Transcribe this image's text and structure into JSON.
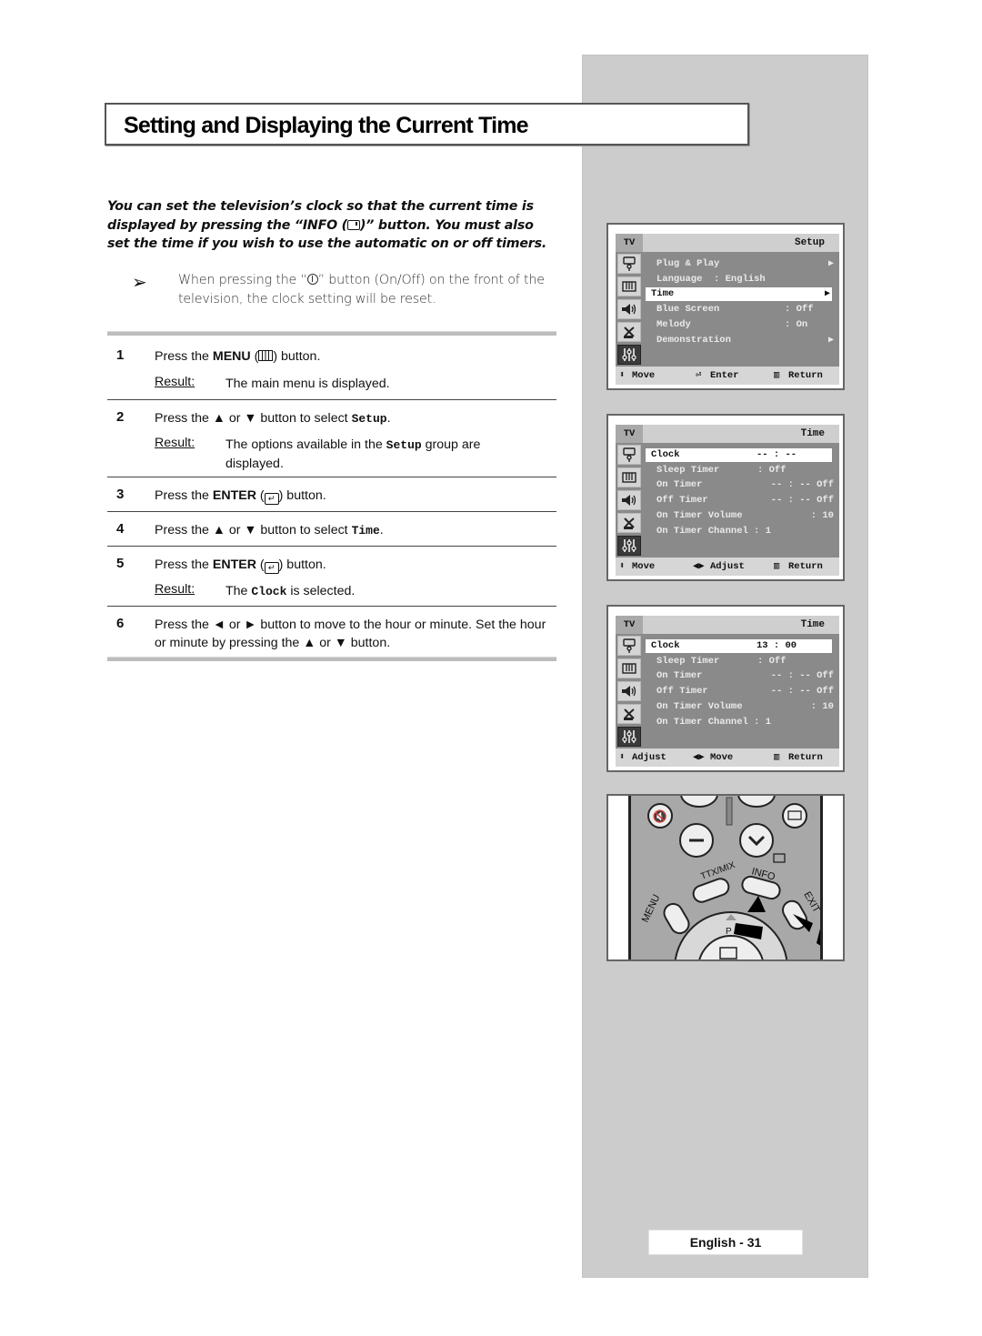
{
  "page": {
    "title": "Setting and Displaying the Current Time",
    "intro": {
      "part1": "You can set the television’s clock so that the current time is displayed by pressing the “INFO (",
      "part2": ")” button. You must also set the time if you wish to use the automatic on or off timers."
    },
    "note": {
      "arrow_icon": "➢",
      "part1": "When pressing the “",
      "part2": "” button (On/Off) on the front of the television, the clock setting will be reset."
    },
    "result_label": "Result:",
    "steps": [
      {
        "number": "1",
        "pre": "Press the ",
        "bold": "MENU",
        "mid": " (",
        "post": ") button.",
        "result": "The main menu is displayed."
      },
      {
        "number": "2",
        "pre": "Press the ▲ or ▼ button to select ",
        "mono": "Setup",
        "post": ".",
        "result_pre": "The options available in the ",
        "result_mono": "Setup",
        "result_post": " group are displayed."
      },
      {
        "number": "3",
        "pre": "Press the ",
        "bold": "ENTER",
        "mid": " (",
        "post": ") button."
      },
      {
        "number": "4",
        "pre": "Press the ▲ or ▼ button to select ",
        "mono": "Time",
        "post": "."
      },
      {
        "number": "5",
        "pre": "Press the ",
        "bold": "ENTER",
        "mid": " (",
        "post": ") button.",
        "result_pre": "The ",
        "result_mono": "Clock",
        "result_post": " is selected."
      },
      {
        "number": "6",
        "text": "Press the ◄ or ► button to move to the hour or minute. Set the hour or minute by pressing the ▲ or ▼ button."
      }
    ],
    "page_number": "English - 31"
  },
  "osd_panels": [
    {
      "tv_label": "TV",
      "title": "Setup",
      "rows": [
        {
          "label": "Plug & Play",
          "value": "",
          "arrow": "▶"
        },
        {
          "label": "Language  : English",
          "value": "",
          "arrow": ""
        },
        {
          "label": "Time",
          "value": "",
          "arrow": "▶",
          "selected": true
        },
        {
          "label": "Blue Screen",
          "value": ": Off",
          "arrow": ""
        },
        {
          "label": "Melody",
          "value": ": On",
          "arrow": ""
        },
        {
          "label": "Demonstration",
          "value": "",
          "arrow": "▶"
        }
      ],
      "footer": {
        "left_icon": "⬍",
        "left": "Move",
        "mid_icon": "enter-icon",
        "mid": "Enter",
        "right": "Return"
      }
    },
    {
      "tv_label": "TV",
      "title": "Time",
      "rows": [
        {
          "label": "Clock",
          "value": "-- : --",
          "selected": true
        },
        {
          "label": "Sleep Timer",
          "value": ": Off"
        },
        {
          "label": "On Timer",
          "value": "-- : -- Off"
        },
        {
          "label": "Off Timer",
          "value": "-- : -- Off"
        },
        {
          "label": "On Timer Volume",
          "value": ": 10"
        },
        {
          "label": "On Timer Channel : 1",
          "value": ""
        }
      ],
      "footer": {
        "left_icon": "⬍",
        "left": "Move",
        "mid_icon": "◀▶",
        "mid": "Adjust",
        "right": "Return"
      }
    },
    {
      "tv_label": "TV",
      "title": "Time",
      "rows": [
        {
          "label": "Clock",
          "value": "13 : 00",
          "selected": true
        },
        {
          "label": "Sleep Timer",
          "value": ": Off"
        },
        {
          "label": "On Timer",
          "value": "-- : -- Off"
        },
        {
          "label": "Off Timer",
          "value": "-- : -- Off"
        },
        {
          "label": "On Timer Volume",
          "value": ": 10"
        },
        {
          "label": "On Timer Channel : 1",
          "value": ""
        }
      ],
      "footer": {
        "left_icon": "⬍",
        "left": "Adjust",
        "mid_icon": "◀▶",
        "mid": "Move",
        "right": "Return"
      }
    }
  ],
  "remote": {
    "labels": {
      "ttx": "TTX/MIX",
      "info": "INFO",
      "menu": "MENU",
      "exit": "EXIT",
      "p": "P"
    }
  }
}
